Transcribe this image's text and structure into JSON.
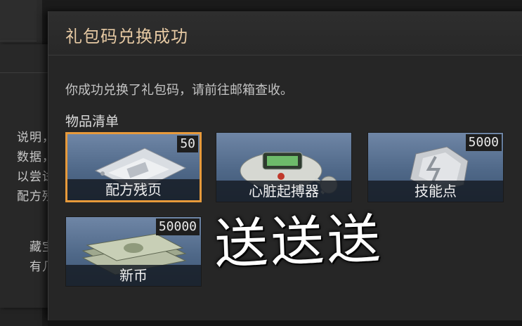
{
  "background_panel": {
    "lines": [
      "说明，",
      "数据，",
      "以尝试",
      "配方残",
      "藏宝",
      "有几"
    ]
  },
  "dialog": {
    "title": "礼包码兑换成功",
    "message": "你成功兑换了礼包码，请前往邮箱查收。",
    "list_title": "物品清单",
    "items": [
      {
        "name": "配方残页",
        "quantity": "50",
        "icon": "recipe-fragment-icon",
        "selected": true
      },
      {
        "name": "心脏起搏器",
        "quantity": "",
        "icon": "pacemaker-icon",
        "selected": false
      },
      {
        "name": "技能点",
        "quantity": "5000",
        "icon": "skill-point-icon",
        "selected": false
      },
      {
        "name": "新币",
        "quantity": "50000",
        "icon": "cash-stack-icon",
        "selected": false
      }
    ]
  },
  "overlay_text": "送送送",
  "colors": {
    "title": "#e6c9a3",
    "selected_border": "#e79a3b",
    "item_bg": "#5a7394"
  }
}
